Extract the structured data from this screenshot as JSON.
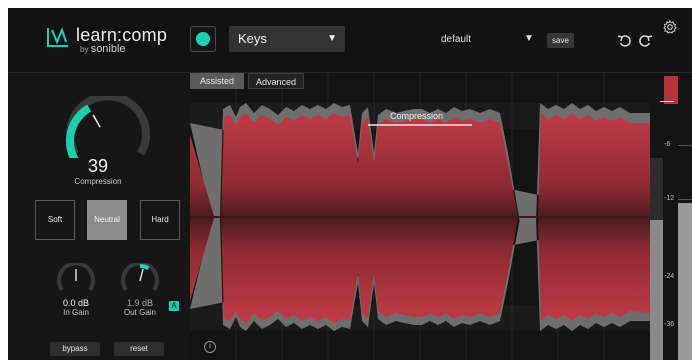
{
  "app": {
    "name": "learn:comp",
    "by": "by",
    "brand": "sonible",
    "accent_color": "#19d0b0",
    "wave_color": "#b8323e"
  },
  "header": {
    "profile": "Keys",
    "preset": "default",
    "save_label": "save"
  },
  "compression": {
    "value": "39",
    "label": "Compression",
    "level": 0.39
  },
  "modes": [
    {
      "label": "Soft",
      "active": false
    },
    {
      "label": "Neutral",
      "active": true
    },
    {
      "label": "Hard",
      "active": false
    }
  ],
  "in_gain": {
    "value": "0.0 dB",
    "label": "In Gain"
  },
  "out_gain": {
    "value": "1.9 dB",
    "label": "Out Gain",
    "auto_badge": "A"
  },
  "buttons": {
    "bypass": "bypass",
    "reset": "reset"
  },
  "tabs": [
    {
      "label": "Assisted",
      "active": true
    },
    {
      "label": "Advanced",
      "active": false
    }
  ],
  "threshold_label": "Compression",
  "info_icon": "i",
  "meter": {
    "ticks": [
      "-6",
      "-12",
      "-24",
      "-36"
    ]
  }
}
